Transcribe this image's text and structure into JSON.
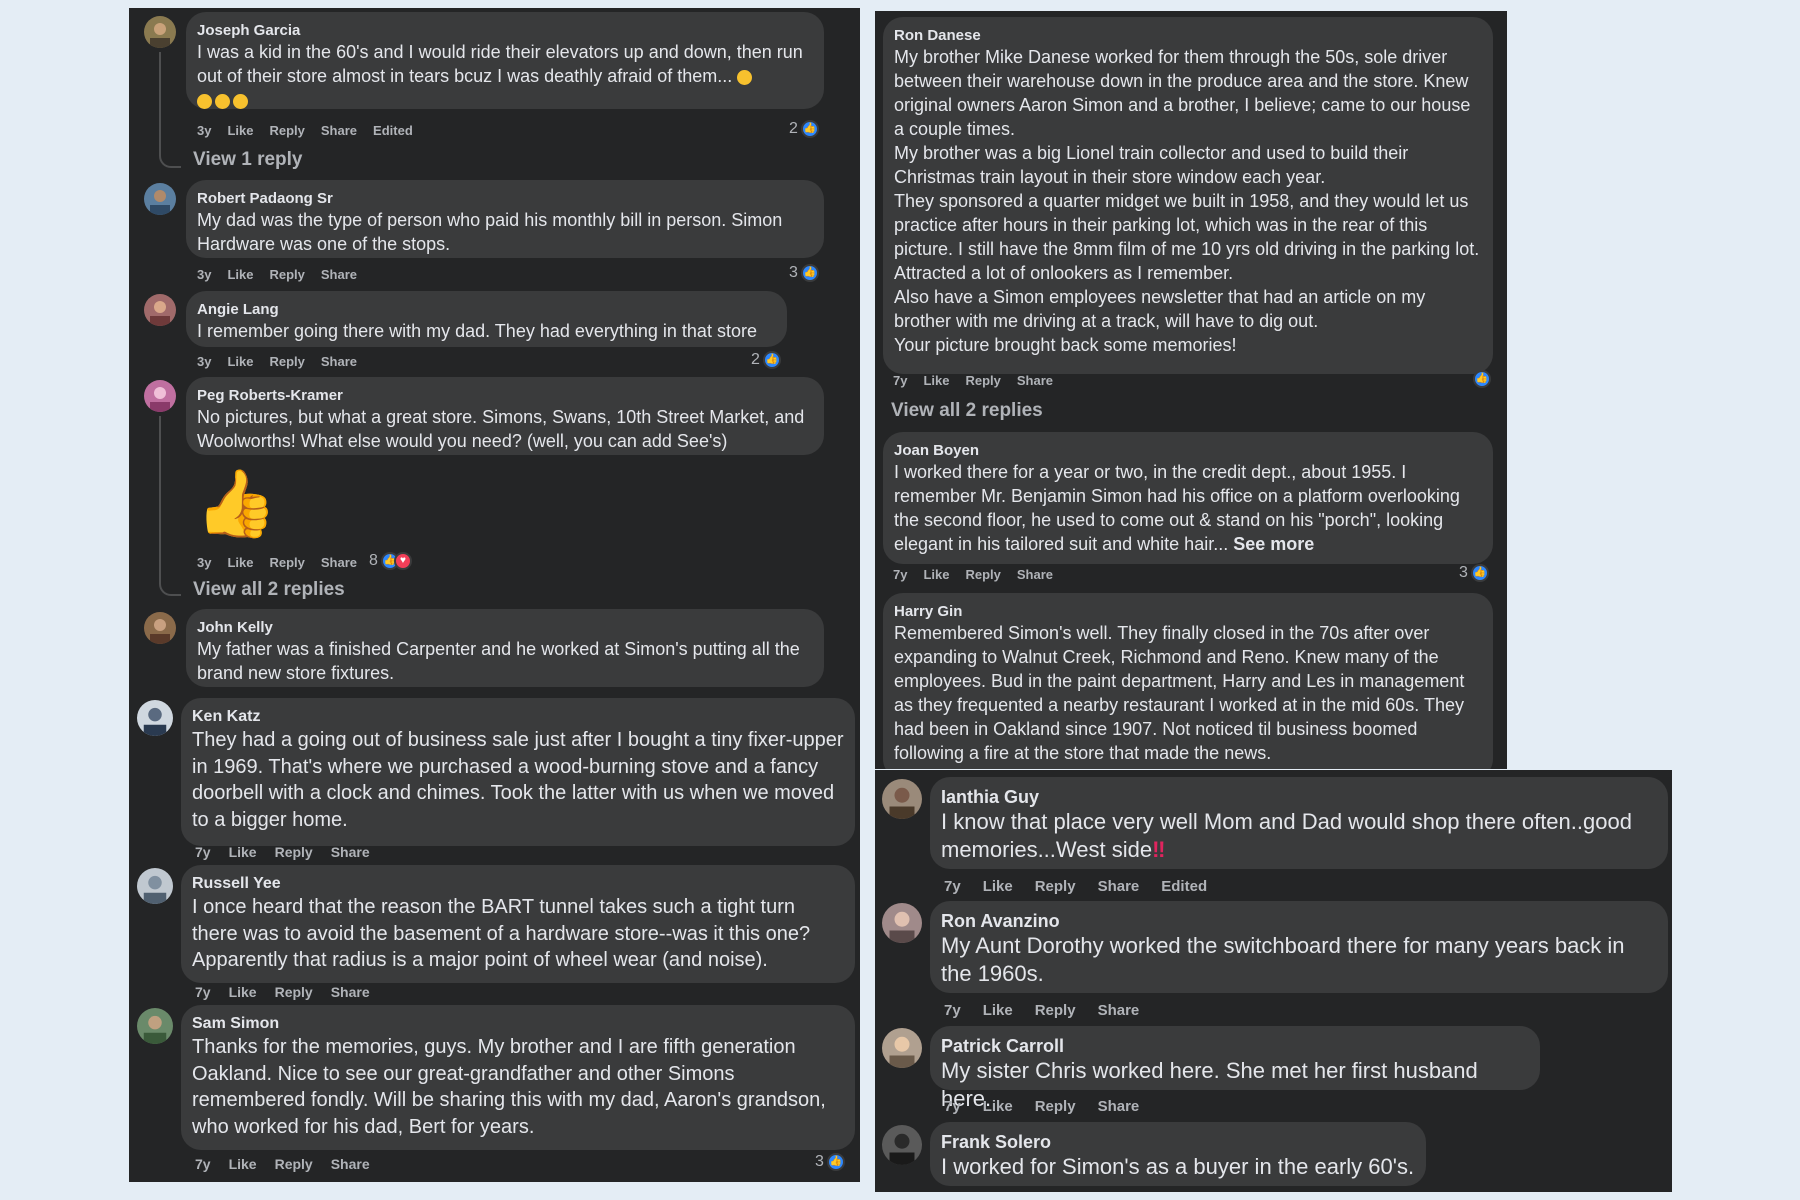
{
  "left_top": {
    "comments": [
      {
        "name": "Joseph Garcia",
        "text": "I was a kid in the 60's and I would ride their elevators up and down, then run out of their store almost in tears bcuz I was deathly afraid of them...",
        "time": "3y",
        "like": "Like",
        "reply": "Reply",
        "share": "Share",
        "edited": "Edited",
        "reactions": "2",
        "view_replies": "View 1 reply"
      },
      {
        "name": "Robert Padaong Sr",
        "text": "My dad was the type of person who paid his monthly bill in person. Simon Hardware was one of the stops.",
        "time": "3y",
        "like": "Like",
        "reply": "Reply",
        "share": "Share",
        "reactions": "3"
      },
      {
        "name": "Angie Lang",
        "text": "I remember going there with my dad. They had everything in that store",
        "time": "3y",
        "like": "Like",
        "reply": "Reply",
        "share": "Share",
        "reactions": "2"
      },
      {
        "name": "Peg Roberts-Kramer",
        "text": "No pictures, but what a great store. Simons, Swans, 10th Street Market, and Woolworths! What else would you need? (well, you can add See's)",
        "time": "3y",
        "like": "Like",
        "reply": "Reply",
        "share": "Share",
        "reactions": "8",
        "view_replies": "View all 2 replies"
      },
      {
        "name": "John Kelly",
        "text": "My father was a finished Carpenter and he worked at Simon's putting all the brand new store fixtures."
      }
    ]
  },
  "left_bottom": {
    "comments": [
      {
        "name": "Ken Katz",
        "text": "They had a going out of business sale just after I bought a tiny fixer-upper in 1969. That's where we purchased a wood-burning stove and a fancy doorbell with a clock and chimes. Took the latter with us when we moved to a bigger home.",
        "time": "7y",
        "like": "Like",
        "reply": "Reply",
        "share": "Share"
      },
      {
        "name": "Russell Yee",
        "text": "I once heard that the reason the BART tunnel takes such a tight turn there was to avoid the basement of a hardware store--was it this one? Apparently that radius is a major point of wheel wear (and noise).",
        "time": "7y",
        "like": "Like",
        "reply": "Reply",
        "share": "Share"
      },
      {
        "name": "Sam Simon",
        "text": "Thanks for the memories, guys. My brother and I are fifth generation Oakland. Nice to see our great-grandfather and other Simons remembered fondly. Will be sharing this with my dad, Aaron's grandson, who worked for his dad, Bert for years.",
        "time": "7y",
        "like": "Like",
        "reply": "Reply",
        "share": "Share",
        "reactions": "3"
      }
    ]
  },
  "right_top": {
    "comments": [
      {
        "name": "Ron Danese",
        "text": "My brother Mike Danese worked for them through the 50s, sole driver between their warehouse down in the produce area and the store. Knew original owners Aaron Simon and a brother, I believe; came to our house a couple times.\nMy brother was a big Lionel train collector and used to build their Christmas train layout in their store window each year.\nThey sponsored a quarter midget we built in 1958, and they would let us practice after hours in their parking lot, which was in the rear of this picture. I still have the 8mm film of me 10 yrs old driving in the parking lot. Attracted a lot of onlookers as I remember.\nAlso have a Simon employees newsletter that had an article on my brother with me driving at a track, will have to dig out.\nYour picture brought back some memories!",
        "time": "7y",
        "like": "Like",
        "reply": "Reply",
        "share": "Share",
        "view_replies": "View all 2 replies"
      },
      {
        "name": "Joan Boyen",
        "text": "I worked there for a year or two, in the credit dept., about 1955. I remember Mr. Benjamin Simon had his office on a platform overlooking the second floor, he used to come out & stand on his \"porch\", looking elegant in his tailored suit and white hair...",
        "see_more": "See more",
        "time": "7y",
        "like": "Like",
        "reply": "Reply",
        "share": "Share",
        "reactions": "3"
      },
      {
        "name": "Harry Gin",
        "text": "Remembered Simon's well. They finally closed in the 70s after over expanding to Walnut Creek, Richmond and Reno. Knew many of the employees. Bud in the paint department, Harry and Les in management as they frequented a nearby restaurant I worked at in the mid 60s. They had been in Oakland since 1907. Not noticed til business boomed following a fire at the store that made the news."
      }
    ]
  },
  "right_bottom": {
    "comments": [
      {
        "name": "Ianthia Guy",
        "text": "I know that place very well Mom and Dad would shop there often..good memories...West side",
        "time": "7y",
        "like": "Like",
        "reply": "Reply",
        "share": "Share",
        "edited": "Edited"
      },
      {
        "name": "Ron Avanzino",
        "text": "My Aunt Dorothy worked the switchboard there for many years back in the 1960s.",
        "time": "7y",
        "like": "Like",
        "reply": "Reply",
        "share": "Share"
      },
      {
        "name": "Patrick Carroll",
        "text": "My sister Chris worked here. She met her first husband here.",
        "time": "7y",
        "like": "Like",
        "reply": "Reply",
        "share": "Share"
      },
      {
        "name": "Frank Solero",
        "text": "I worked for Simon's as a buyer in the early 60's."
      }
    ]
  },
  "icons": {
    "like": "like-icon",
    "love": "love-icon",
    "thumbs_up_sticker": "thumbs-up-icon",
    "laughing_emoji": "laughing-emoji-icon",
    "double_exclamation": "double-exclamation-icon"
  },
  "colors": {
    "panel": "#242526",
    "bubble": "#3a3b3c",
    "text": "#e4e6eb",
    "meta": "#b0b3b8",
    "like_blue": "#2d88ff",
    "love_red": "#f33e58",
    "background": "#e4edf5"
  }
}
